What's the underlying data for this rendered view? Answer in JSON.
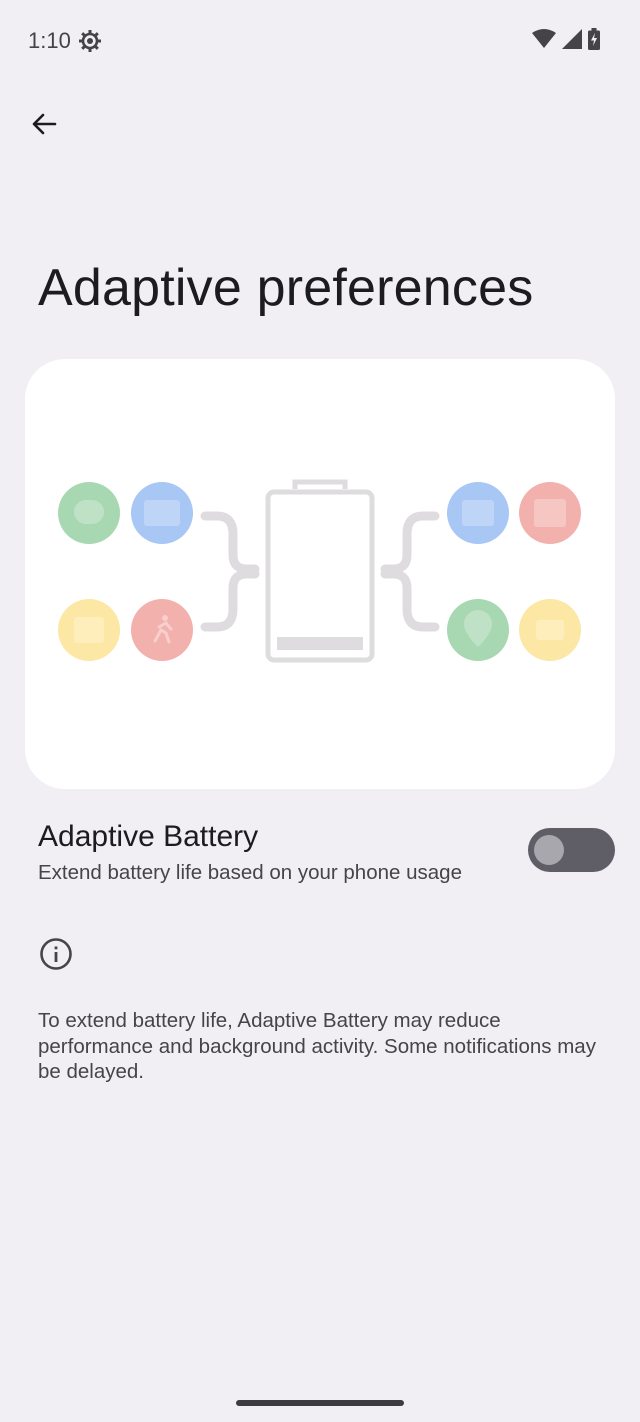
{
  "status_bar": {
    "time": "1:10",
    "icons": [
      "settings-gear-icon",
      "wifi-icon",
      "cellular-signal-icon",
      "battery-charging-icon"
    ]
  },
  "app_bar": {
    "back_icon": "arrow-back-icon"
  },
  "page": {
    "title": "Adaptive preferences"
  },
  "illustration": {
    "app_icon_colors": {
      "green": "#a8d8b2",
      "blue": "#a8c7f5",
      "yellow": "#fce7a4",
      "red": "#f3b1ad"
    },
    "battery_icon": "battery-outline-icon"
  },
  "adaptive_battery": {
    "title": "Adaptive Battery",
    "summary": "Extend battery life based on your phone usage",
    "toggle_state": "off"
  },
  "footer": {
    "info_icon": "info-icon",
    "text": "To extend battery life, Adaptive Battery may reduce performance and background activity. Some notifications may be delayed."
  }
}
